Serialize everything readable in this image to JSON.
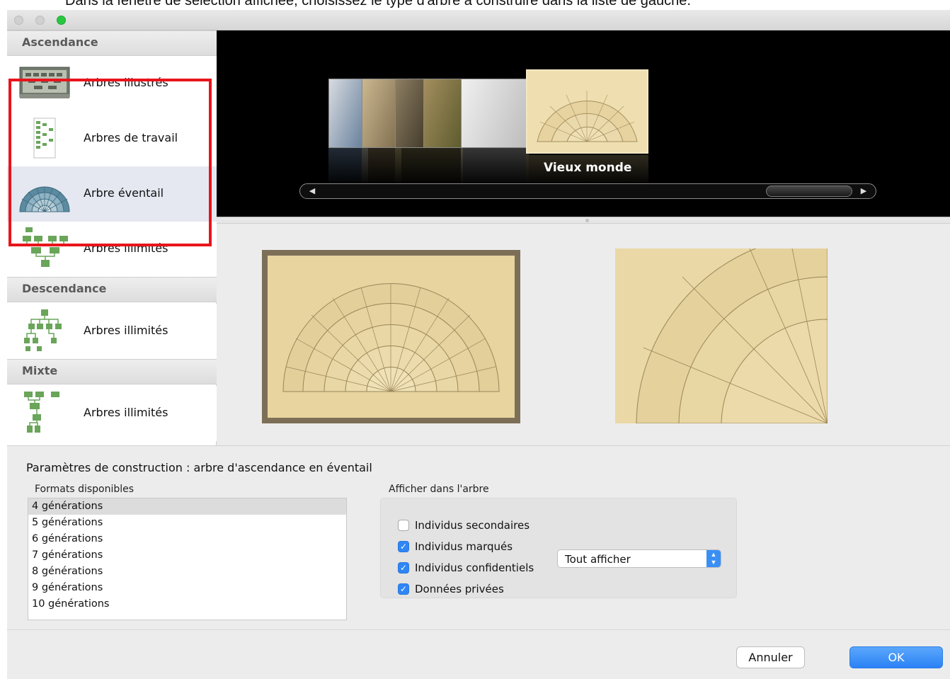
{
  "caption": "Dans la fenêtre de sélection affichée, choisissez le type d'arbre à construire dans la liste de gauche.",
  "sidebar": {
    "sections": [
      {
        "header": "Ascendance",
        "items": [
          {
            "label": "Arbres illustrés",
            "icon": "illustrated-tree-thumbnail",
            "selected": false
          },
          {
            "label": "Arbres de travail",
            "icon": "working-tree-thumbnail",
            "selected": false
          },
          {
            "label": "Arbre éventail",
            "icon": "fan-tree-thumbnail",
            "selected": true
          },
          {
            "label": "Arbres illimités",
            "icon": "unlimited-tree-thumbnail",
            "selected": false
          }
        ]
      },
      {
        "header": "Descendance",
        "items": [
          {
            "label": "Arbres illimités",
            "icon": "descendant-tree-thumbnail",
            "selected": false
          }
        ]
      },
      {
        "header": "Mixte",
        "items": [
          {
            "label": "Arbres illimités",
            "icon": "mixed-tree-thumbnail",
            "selected": false
          }
        ]
      }
    ],
    "highlight_color": "#e8141c"
  },
  "carousel": {
    "selected_style": "Vieux monde"
  },
  "params": {
    "title": "Paramètres de construction : arbre d'ascendance en éventail",
    "formats_label": "Formats disponibles",
    "formats": [
      "4 générations",
      "5 générations",
      "6 générations",
      "7 générations",
      "8 générations",
      "9 générations",
      "10 générations"
    ],
    "selected_format": "4 générations",
    "afficher_label": "Afficher dans l'arbre",
    "options": [
      {
        "label": "Individus secondaires",
        "checked": false
      },
      {
        "label": "Individus marqués",
        "checked": true
      },
      {
        "label": "Individus confidentiels",
        "checked": true
      },
      {
        "label": "Données privées",
        "checked": true
      }
    ],
    "confidential_select": "Tout afficher"
  },
  "buttons": {
    "cancel": "Annuler",
    "ok": "OK"
  },
  "colors": {
    "accent": "#2f86f5",
    "parchment": "#e8d49f"
  }
}
